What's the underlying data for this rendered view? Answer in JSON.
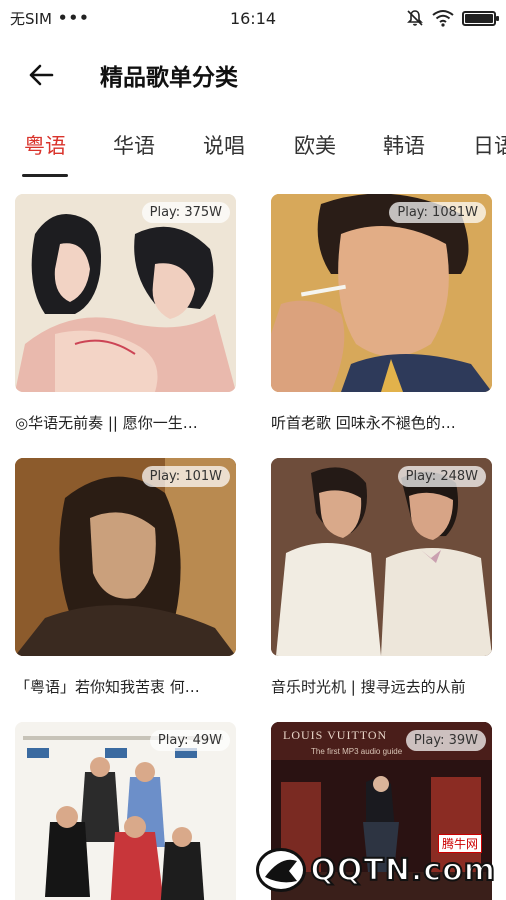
{
  "status_bar": {
    "carrier": "无SIM",
    "dots": "•••",
    "time": "16:14",
    "battery_level": 0.92
  },
  "header": {
    "title": "精品歌单分类"
  },
  "tabs": [
    {
      "label": "粤语",
      "active": true
    },
    {
      "label": "华语",
      "active": false
    },
    {
      "label": "说唱",
      "active": false
    },
    {
      "label": "欧美",
      "active": false
    },
    {
      "label": "韩语",
      "active": false
    },
    {
      "label": "日语",
      "active": false
    }
  ],
  "playlists": [
    {
      "play": "Play: 375W",
      "title": "◎华语无前奏 || 愿你一生…"
    },
    {
      "play": "Play: 1081W",
      "title": "听首老歌 回味永不褪色的…"
    },
    {
      "play": "Play: 101W",
      "title": "「粤语」若你知我苦衷 何…"
    },
    {
      "play": "Play: 248W",
      "title": "音乐时光机 | 搜寻远去的从前"
    },
    {
      "play": "Play: 49W",
      "title": ""
    },
    {
      "play": "Play: 39W",
      "title": ""
    }
  ],
  "cover_texts": {
    "louis_vuitton": "LOUIS VUITTON",
    "lv_subtitle": "The first MP3 audio guide"
  },
  "watermark": {
    "text": "QQTN.com",
    "badge": "腾牛网"
  },
  "colors": {
    "accent": "#d9332b"
  }
}
